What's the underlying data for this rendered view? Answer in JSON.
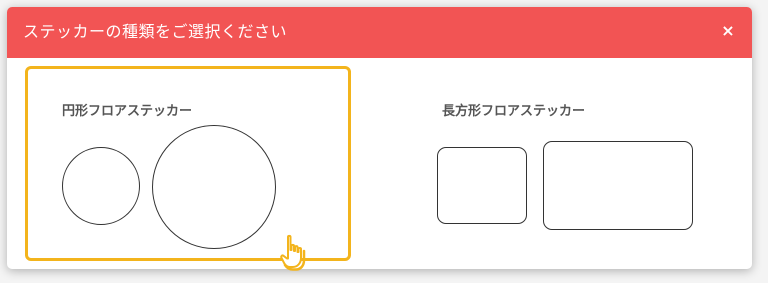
{
  "dialog": {
    "title": "ステッカーの種類をご選択ください",
    "close_label": "×"
  },
  "options": [
    {
      "label": "円形フロアステッカー",
      "selected": true
    },
    {
      "label": "長方形フロアステッカー",
      "selected": false
    }
  ],
  "colors": {
    "header": "#f25454",
    "selected_border": "#f3b41c",
    "shape_stroke": "#333333",
    "label_text": "#555555"
  },
  "icons": {
    "close": "close-icon",
    "cursor": "hand-pointer-icon"
  }
}
